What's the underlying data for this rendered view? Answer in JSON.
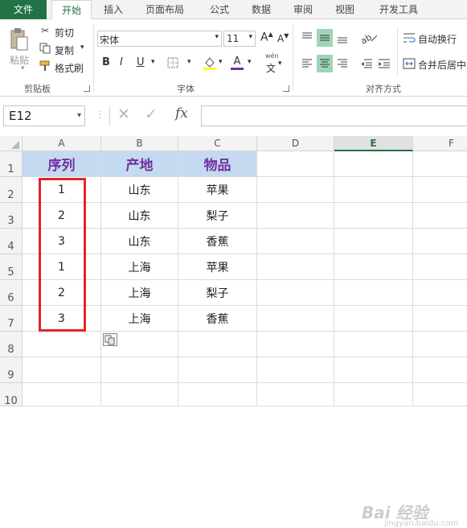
{
  "ribbon_tabs": {
    "file": "文件",
    "home": "开始",
    "insert": "插入",
    "page_layout": "页面布局",
    "formulas": "公式",
    "data": "数据",
    "review": "审阅",
    "view": "视图",
    "developer": "开发工具"
  },
  "clipboard": {
    "paste": "粘贴",
    "cut": "剪切",
    "copy": "复制",
    "format_painter": "格式刷",
    "group_label": "剪贴板"
  },
  "font": {
    "font_name": "宋体",
    "font_size": "11",
    "grow": "A",
    "shrink": "A",
    "bold": "B",
    "italic": "I",
    "underline": "U",
    "font_color_letter": "A",
    "phonetic_top": "wén",
    "phonetic_bottom": "文",
    "group_label": "字体"
  },
  "alignment": {
    "wrap_text": "自动换行",
    "merge_center": "合并后居中",
    "group_label": "对齐方式"
  },
  "formula_bar": {
    "name_box": "E12",
    "cancel_glyph": "✕",
    "enter_glyph": "✓",
    "fx": "fx",
    "formula": ""
  },
  "columns": [
    "A",
    "B",
    "C",
    "D",
    "E",
    "F"
  ],
  "selected_column": "E",
  "rows": [
    "1",
    "2",
    "3",
    "4",
    "5",
    "6",
    "7",
    "8",
    "9",
    "10"
  ],
  "table": {
    "headers": [
      "序列",
      "产地",
      "物品"
    ],
    "data": [
      [
        "1",
        "山东",
        "苹果"
      ],
      [
        "2",
        "山东",
        "梨子"
      ],
      [
        "3",
        "山东",
        "香蕉"
      ],
      [
        "1",
        "上海",
        "苹果"
      ],
      [
        "2",
        "上海",
        "梨子"
      ],
      [
        "3",
        "上海",
        "香蕉"
      ]
    ]
  },
  "colors": {
    "accent": "#217346",
    "header_fill": "#c5d9f1",
    "header_text": "#7030a0",
    "highlight_border": "#e0262b"
  },
  "watermark": {
    "text": "Bai 经验",
    "sub": "jingyan.baidu.com"
  }
}
